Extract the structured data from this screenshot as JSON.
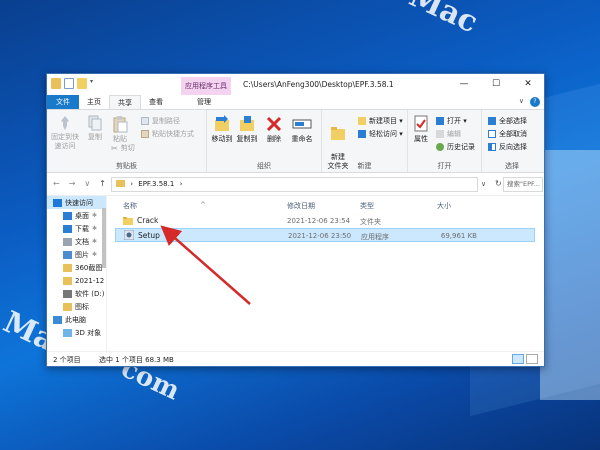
{
  "watermarks": [
    "Mac",
    "Mac",
    "com"
  ],
  "titlebar": {
    "context_tab": "应用程序工具",
    "path": "C:\\Users\\AnFeng300\\Desktop\\EPF.3.58.1",
    "minimize": "—",
    "maximize": "☐",
    "close": "✕"
  },
  "tabs": {
    "file": "文件",
    "home": "主页",
    "share": "共享",
    "view": "查看",
    "manage": "管理",
    "collapse": "∨",
    "help": "?"
  },
  "ribbon": {
    "clipboard": {
      "pin_label": "固定到快速访问",
      "copy_label": "复制",
      "paste_label": "粘贴",
      "copy_path": "复制路径",
      "paste_shortcut": "粘贴快捷方式",
      "cut": "剪切",
      "group": "剪贴板"
    },
    "organize": {
      "move_to": "移动到",
      "copy_to": "复制到",
      "delete": "删除",
      "rename": "重命名",
      "group": "组织"
    },
    "new": {
      "new_folder": "新建\n文件夹",
      "new_item": "新建项目 ▾",
      "easy_access": "轻松访问 ▾",
      "group": "新建"
    },
    "open": {
      "properties": "属性",
      "open": "打开 ▾",
      "edit": "编辑",
      "history": "历史记录",
      "group": "打开"
    },
    "select": {
      "select_all": "全部选择",
      "select_none": "全部取消",
      "invert": "反向选择",
      "group": "选择"
    }
  },
  "address": {
    "back": "←",
    "forward": "→",
    "recent": "∨",
    "up": "↑",
    "sep1": "›",
    "path": "EPF.3.58.1",
    "sep2": "›",
    "dropdown": "∨",
    "refresh": "↻",
    "search_placeholder": "搜索\"EPF..."
  },
  "nav": [
    {
      "label": "快速访问",
      "color": "#1e78d7"
    },
    {
      "label": "桌面",
      "color": "#2a7fd4"
    },
    {
      "label": "下载",
      "color": "#2a7fd4"
    },
    {
      "label": "文档",
      "color": "#9aa4b0"
    },
    {
      "label": "图片",
      "color": "#4a8ccf"
    },
    {
      "label": "360截图",
      "color": "#e8c15a"
    },
    {
      "label": "2021-12",
      "color": "#e8c15a"
    },
    {
      "label": "软件 (D:)",
      "color": "#777777"
    },
    {
      "label": "图标",
      "color": "#e8c15a"
    },
    {
      "label": "此电脑",
      "color": "#3a8ad8"
    },
    {
      "label": "3D 对象",
      "color": "#6fb5e8"
    }
  ],
  "nav_pins": [
    "✱",
    "✱",
    "✱",
    "✱"
  ],
  "columns": {
    "name": "名称",
    "modified": "修改日期",
    "type": "类型",
    "size": "大小",
    "sort": "^"
  },
  "files": [
    {
      "name": "Crack",
      "modified": "2021-12-06 23:54",
      "type": "文件夹",
      "size": "",
      "icon": "folder-icon"
    },
    {
      "name": "Setup",
      "modified": "2021-12-06 23:50",
      "type": "应用程序",
      "size": "69,961 KB",
      "icon": "setup-exe-icon"
    }
  ],
  "status": {
    "count": "2 个项目",
    "selected": "选中 1 个项目  68.3 MB"
  },
  "colors": {
    "accent": "#1979ca",
    "selection": "#cce8ff",
    "arrow": "#d42a2a"
  }
}
